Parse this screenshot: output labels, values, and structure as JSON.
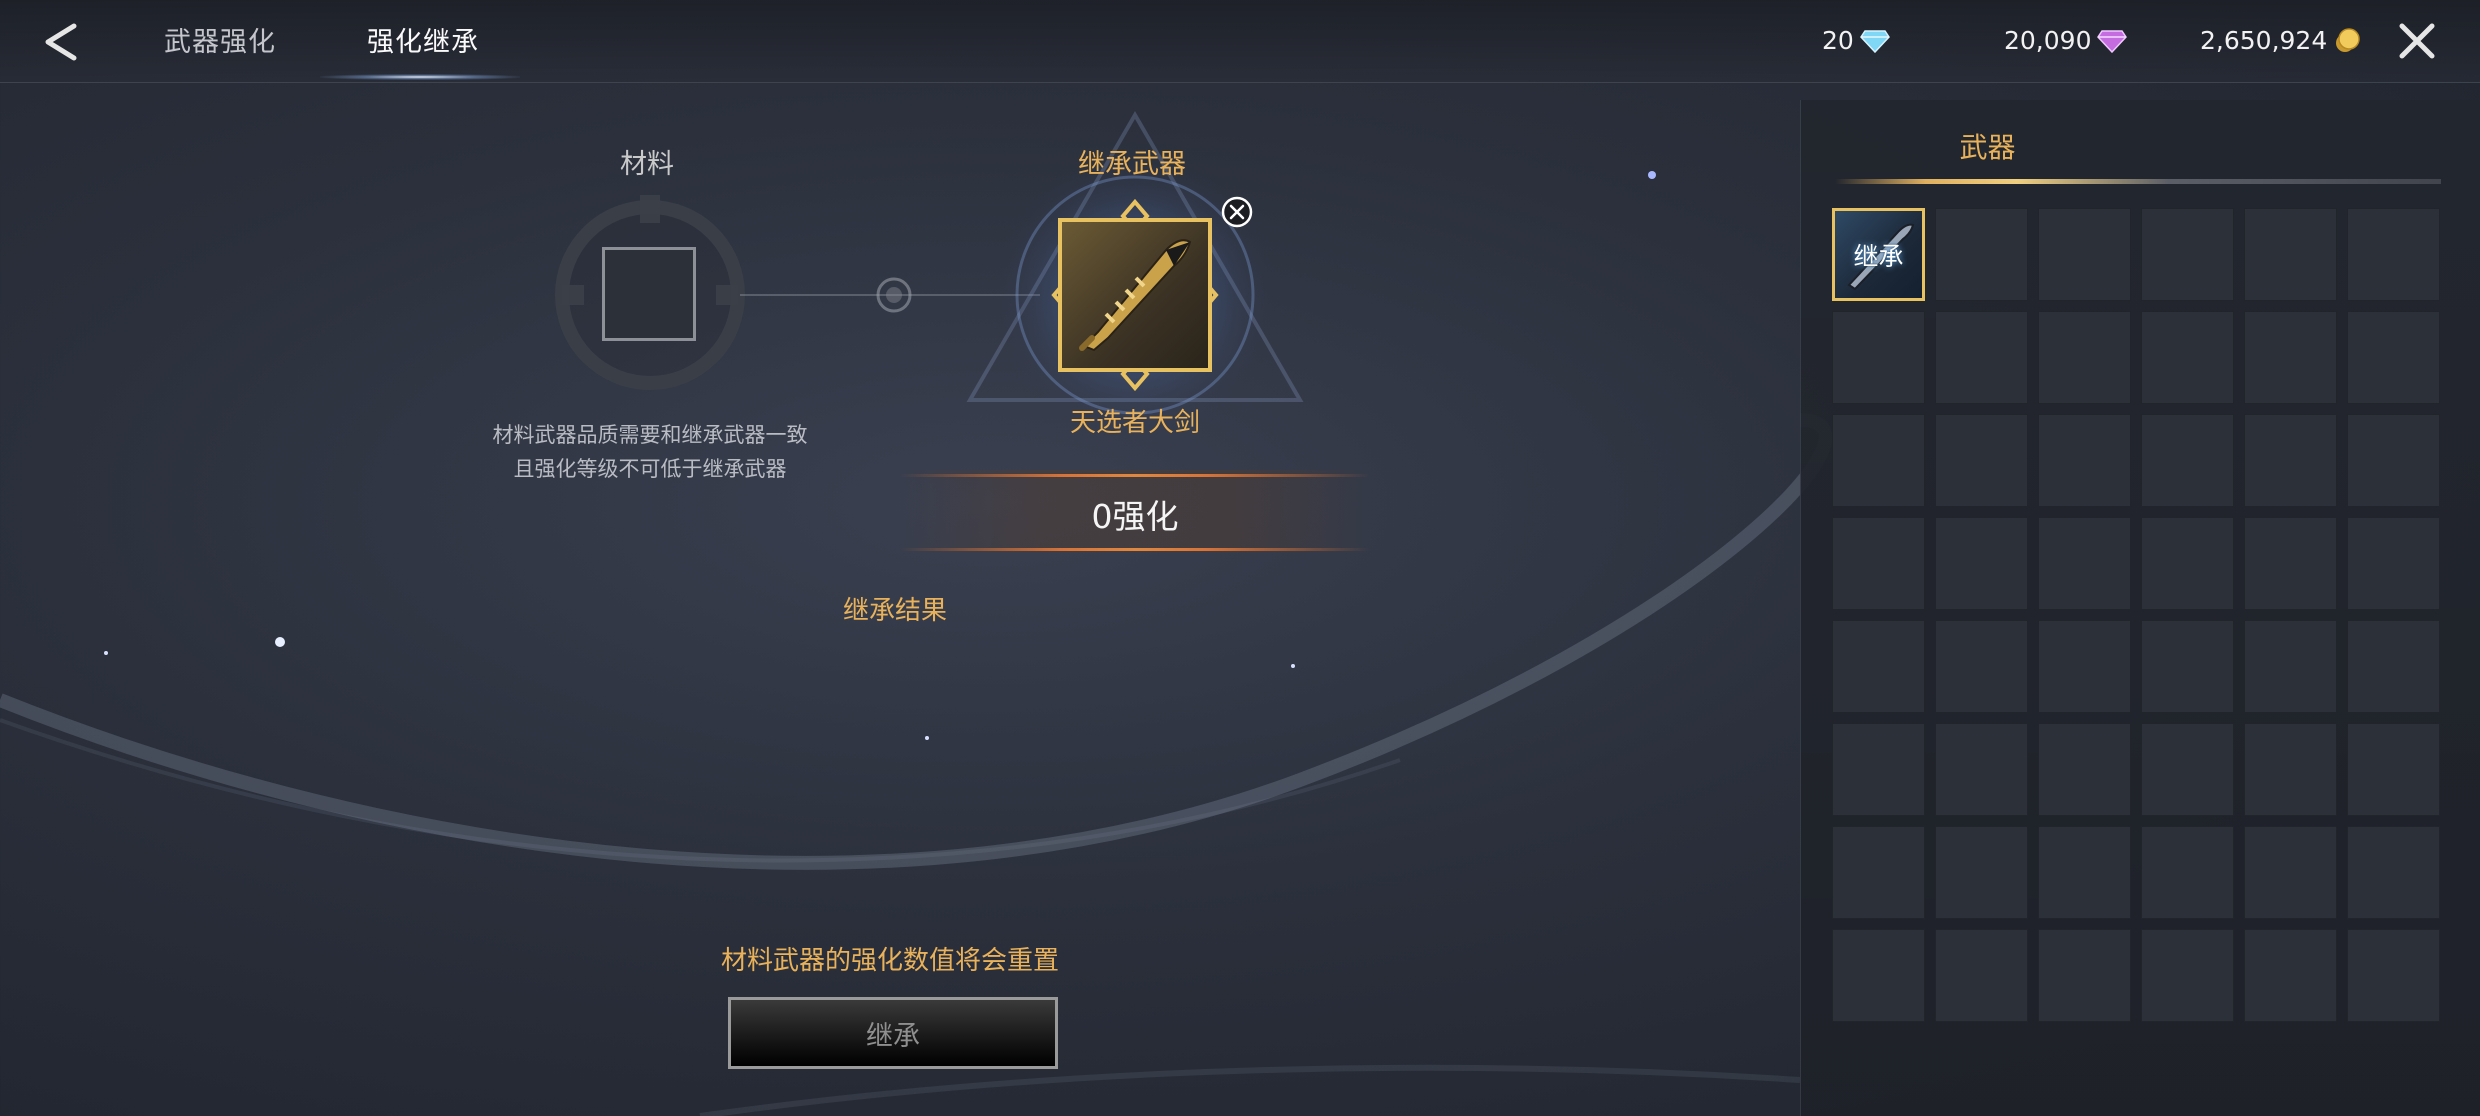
{
  "topbar": {
    "tabs": [
      {
        "label": "武器强化",
        "active": false
      },
      {
        "label": "强化继承",
        "active": true
      }
    ]
  },
  "currencies": [
    {
      "value": "20",
      "icon": "diamond-blue-icon"
    },
    {
      "value": "20,090",
      "icon": "diamond-purple-icon"
    },
    {
      "value": "2,650,924",
      "icon": "gold-coin-icon"
    }
  ],
  "inherit": {
    "material_label": "材料",
    "material_desc_line1": "材料武器品质需要和继承武器一致",
    "material_desc_line2": "且强化等级不可低于继承武器",
    "target_label": "继承武器",
    "weapon_name": "天选者大剑",
    "level_text": "0强化",
    "result_label": "继承结果",
    "warning": "材料武器的强化数值将会重置",
    "button_label": "继承"
  },
  "inventory": {
    "tab_label": "武器",
    "columns": 6,
    "visible_rows": 8,
    "items": [
      {
        "badge": "继承",
        "icon": "greatsword-icon"
      }
    ]
  },
  "colors": {
    "gold_text": "#e9b25a",
    "frame_gold": "#e8c160",
    "accent_orange": "#d8743a"
  }
}
